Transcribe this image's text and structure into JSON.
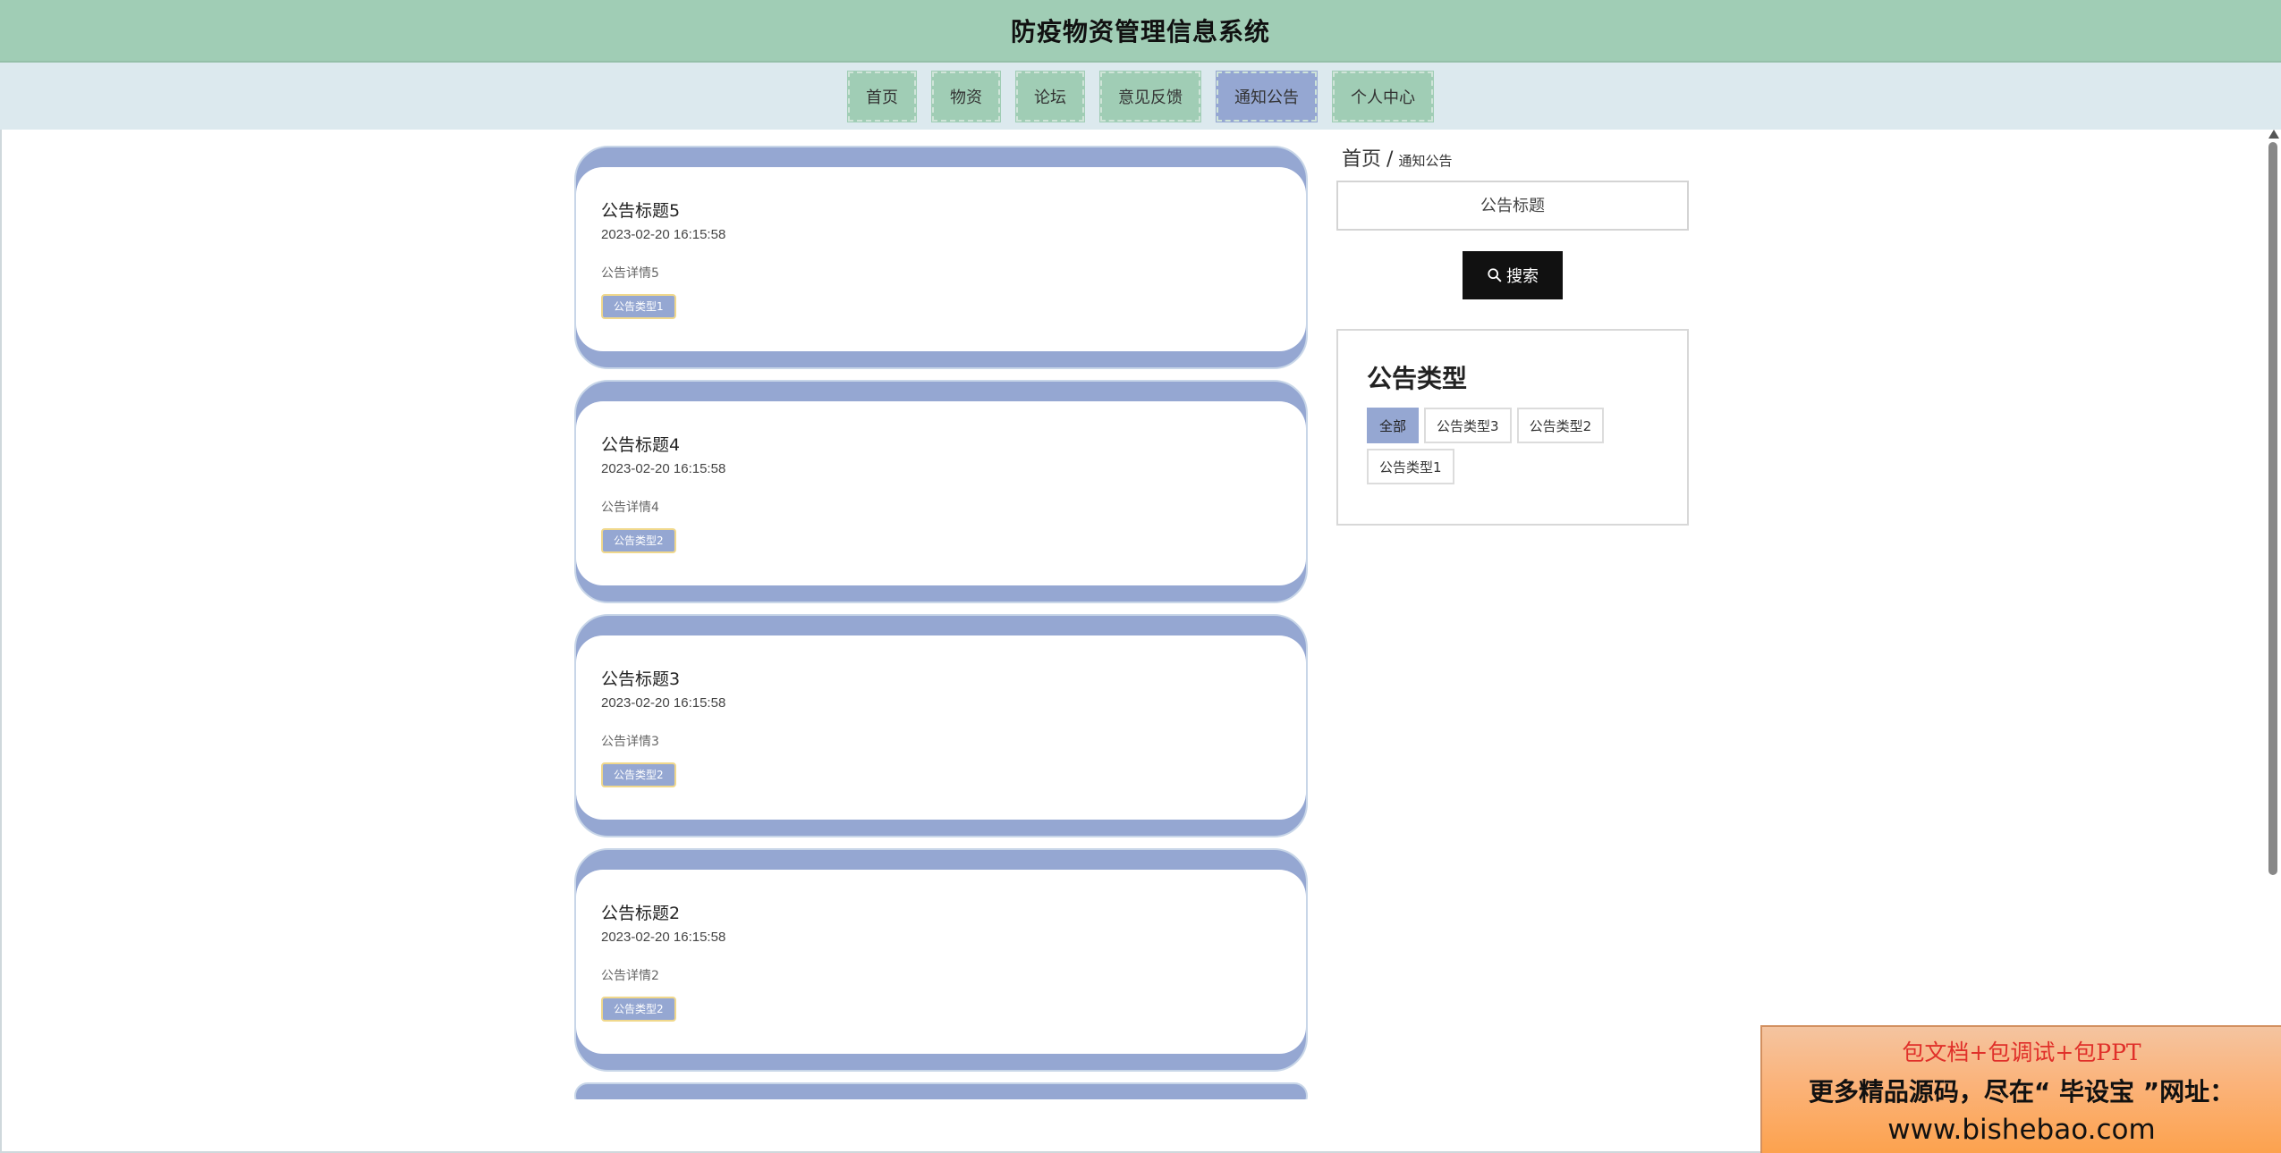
{
  "header": {
    "title": "防疫物资管理信息系统"
  },
  "nav": {
    "items": [
      {
        "label": "首页",
        "active": false
      },
      {
        "label": "物资",
        "active": false
      },
      {
        "label": "论坛",
        "active": false
      },
      {
        "label": "意见反馈",
        "active": false
      },
      {
        "label": "通知公告",
        "active": true
      },
      {
        "label": "个人中心",
        "active": false
      }
    ]
  },
  "breadcrumb": {
    "home": "首页",
    "separator": "/",
    "current": "通知公告"
  },
  "search": {
    "placeholder": "公告标题",
    "button_label": "搜索"
  },
  "type_filter": {
    "heading": "公告类型",
    "options": [
      {
        "label": "全部",
        "active": true
      },
      {
        "label": "公告类型3",
        "active": false
      },
      {
        "label": "公告类型2",
        "active": false
      },
      {
        "label": "公告类型1",
        "active": false
      }
    ]
  },
  "notices": [
    {
      "title": "公告标题5",
      "time": "2023-02-20 16:15:58",
      "desc": "公告详情5",
      "tag": "公告类型1"
    },
    {
      "title": "公告标题4",
      "time": "2023-02-20 16:15:58",
      "desc": "公告详情4",
      "tag": "公告类型2"
    },
    {
      "title": "公告标题3",
      "time": "2023-02-20 16:15:58",
      "desc": "公告详情3",
      "tag": "公告类型2"
    },
    {
      "title": "公告标题2",
      "time": "2023-02-20 16:15:58",
      "desc": "公告详情2",
      "tag": "公告类型2"
    }
  ],
  "ad": {
    "line1": "包文档+包调试+包PPT",
    "line2": "更多精品源码，尽在“ 毕设宝 ”网址：",
    "line3": "www.bishebao.com"
  },
  "colors": {
    "header_bg": "#a0cdb5",
    "nav_bg": "#dce9ee",
    "accent": "#95a7d2",
    "tag_border": "#f0d88c"
  },
  "icons": {
    "search": "search-icon"
  }
}
